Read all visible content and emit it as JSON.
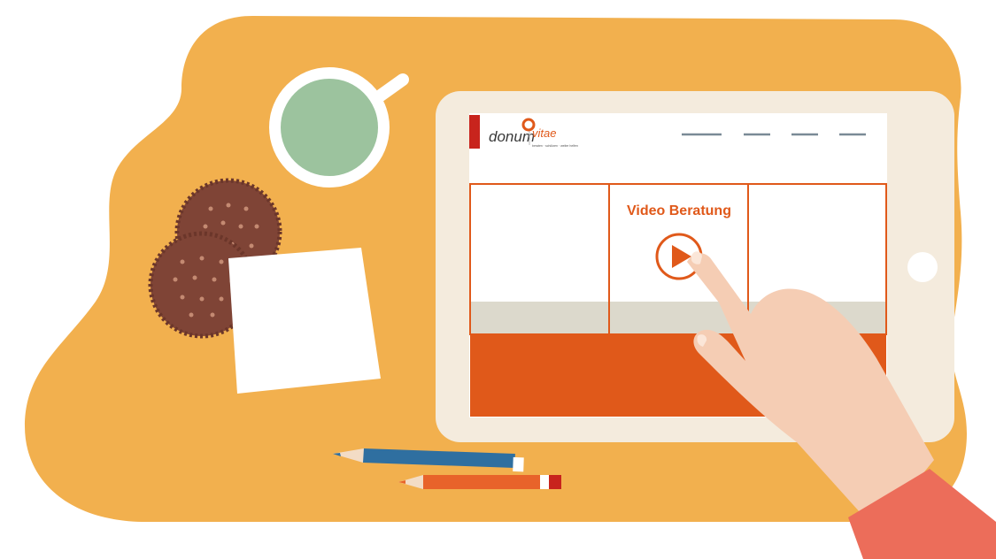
{
  "colors": {
    "background": "#ffffff",
    "blob": "#f2b04e",
    "tablet_frame": "#f4ebdd",
    "accent_orange": "#e0591a",
    "logo_red": "#c8241d",
    "footer_gray": "#dcd9cc",
    "cup_tea": "#9cc39e",
    "cookie": "#7f4436",
    "hand": "#f5cdb4",
    "sleeve": "#ec6d5a",
    "pencil_blue": "#2f6fa0",
    "pencil_orange": "#e8632a"
  },
  "tablet_screen": {
    "logo": {
      "brand_left": "donum",
      "brand_right": "vitae",
      "tagline": "beraten · schützen · weiter helfen"
    },
    "nav_items_count": 4,
    "cards": [
      {
        "title": ""
      },
      {
        "title": "Video Beratung"
      },
      {
        "title": ""
      }
    ]
  },
  "icons": {
    "play": "play-icon",
    "menu": "menu-lines"
  }
}
